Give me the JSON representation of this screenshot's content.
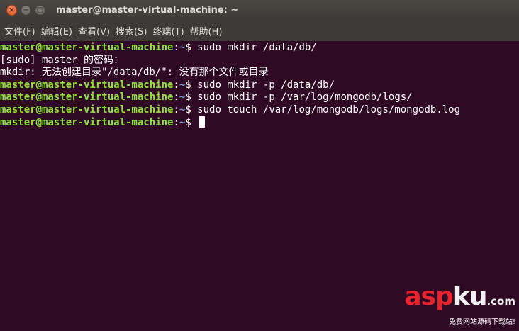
{
  "window": {
    "title": "master@master-virtual-machine: ~",
    "close_glyph": "×",
    "minimize_glyph": "−",
    "maximize_glyph": "□"
  },
  "menu": {
    "items": [
      "文件(F)",
      "编辑(E)",
      "查看(V)",
      "搜索(S)",
      "终端(T)",
      "帮助(H)"
    ]
  },
  "terminal": {
    "prompt_user": "master@master-virtual-machine",
    "prompt_sep": ":",
    "prompt_path": "~",
    "prompt_symbol": "$ ",
    "commands": {
      "c1": "sudo mkdir /data/db/",
      "c2": "sudo mkdir -p /data/db/",
      "c3": "sudo mkdir -p /var/log/mongodb/logs/",
      "c4": "sudo touch /var/log/mongodb/logs/mongodb.log"
    },
    "output": {
      "o1": "[sudo] master 的密码：",
      "o2": "mkdir: 无法创建目录\"/data/db/\": 没有那个文件或目录"
    }
  },
  "watermark": {
    "brand_red": "asp",
    "brand_white": "ku",
    "domain": ".com",
    "tagline": "免费网站源码下载站!"
  },
  "colors": {
    "terminal_bg": "#300a24",
    "prompt_user": "#8ae234",
    "prompt_path": "#729fcf",
    "text": "#ffffff",
    "titlebar": "#3c3b37",
    "close_button": "#e15b1f",
    "watermark_red": "#e8232c"
  }
}
